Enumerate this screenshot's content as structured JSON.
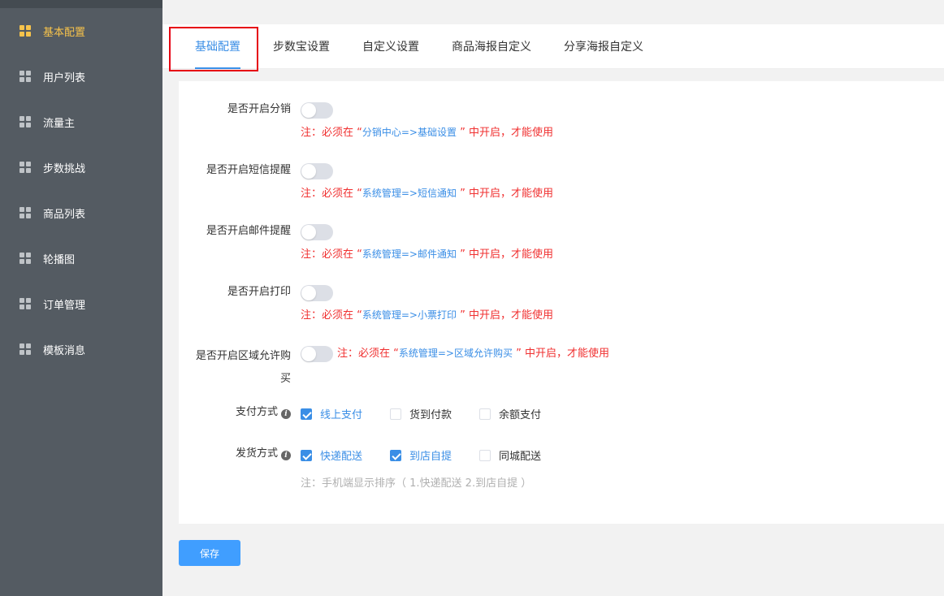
{
  "sidebar": {
    "items": [
      {
        "label": "基本配置",
        "active": true
      },
      {
        "label": "用户列表"
      },
      {
        "label": "流量主"
      },
      {
        "label": "步数挑战"
      },
      {
        "label": "商品列表"
      },
      {
        "label": "轮播图"
      },
      {
        "label": "订单管理"
      },
      {
        "label": "模板消息"
      }
    ]
  },
  "tabs": [
    {
      "label": "基础配置",
      "active": true
    },
    {
      "label": "步数宝设置"
    },
    {
      "label": "自定义设置"
    },
    {
      "label": "商品海报自定义"
    },
    {
      "label": "分享海报自定义"
    }
  ],
  "form": {
    "toggles": [
      {
        "label": "是否开启分销",
        "on": false,
        "note_prefix": "注：必须在 “",
        "note_path": "分销中心=>基础设置",
        "note_suffix": " ” 中开启，才能使用"
      },
      {
        "label": "是否开启短信提醒",
        "on": false,
        "note_prefix": "注：必须在 “",
        "note_path": "系统管理=>短信通知",
        "note_suffix": " ” 中开启，才能使用"
      },
      {
        "label": "是否开启邮件提醒",
        "on": false,
        "note_prefix": "注：必须在 “",
        "note_path": "系统管理=>邮件通知",
        "note_suffix": " ” 中开启，才能使用"
      },
      {
        "label": "是否开启打印",
        "on": false,
        "note_prefix": "注：必须在 “",
        "note_path": "系统管理=>小票打印",
        "note_suffix": " ” 中开启，才能使用"
      },
      {
        "label_line1": "是否开启区域允许购",
        "label_line2": "买",
        "on": false,
        "note_prefix": "注：必须在 “",
        "note_path": "系统管理=>区域允许购买",
        "note_suffix": " ” 中开启，才能使用"
      }
    ],
    "payment": {
      "label": "支付方式",
      "options": [
        {
          "label": "线上支付",
          "checked": true
        },
        {
          "label": "货到付款",
          "checked": false
        },
        {
          "label": "余额支付",
          "checked": false
        }
      ]
    },
    "delivery": {
      "label": "发货方式",
      "options": [
        {
          "label": "快递配送",
          "checked": true
        },
        {
          "label": "到店自提",
          "checked": true
        },
        {
          "label": "同城配送",
          "checked": false
        }
      ],
      "hint": "注：手机端显示排序（ 1.快递配送 2.到店自提 ）"
    }
  },
  "save_label": "保存",
  "colors": {
    "accent": "#409eff",
    "sidebar_bg": "#545b62",
    "active_menu": "#f7c34b",
    "note_red": "#f03030",
    "highlight": "#e60012"
  }
}
